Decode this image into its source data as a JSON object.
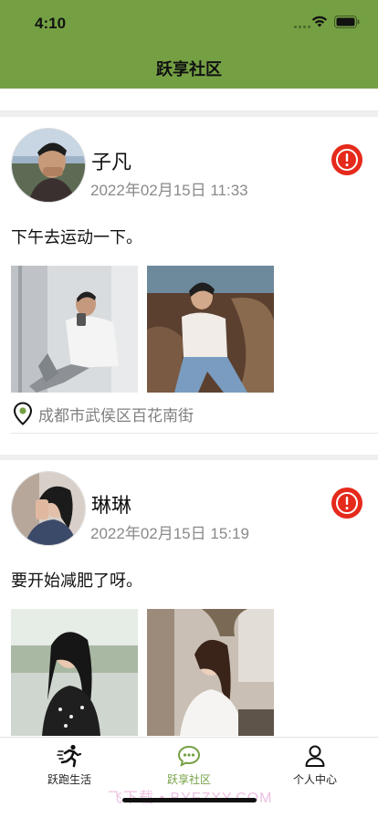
{
  "status_bar": {
    "time": "4:10"
  },
  "nav": {
    "title": "跃享社区"
  },
  "posts": [
    {
      "username": "子凡",
      "time": "2022年02月15日  11:33",
      "content": "下午去运动一下。",
      "location": "成都市武侯区百花南街"
    },
    {
      "username": "琳琳",
      "time": "2022年02月15日  15:19",
      "content": "要开始减肥了呀。"
    }
  ],
  "tabbar": {
    "tabs": [
      {
        "label": "跃跑生活",
        "icon": "runner-icon"
      },
      {
        "label": "跃享社区",
        "icon": "chat-bubble-icon",
        "active": true
      },
      {
        "label": "个人中心",
        "icon": "person-icon"
      }
    ]
  },
  "colors": {
    "accent": "#74a043",
    "report": "#e52a1c"
  },
  "watermark": "飞下载 • BYFZXY.COM"
}
